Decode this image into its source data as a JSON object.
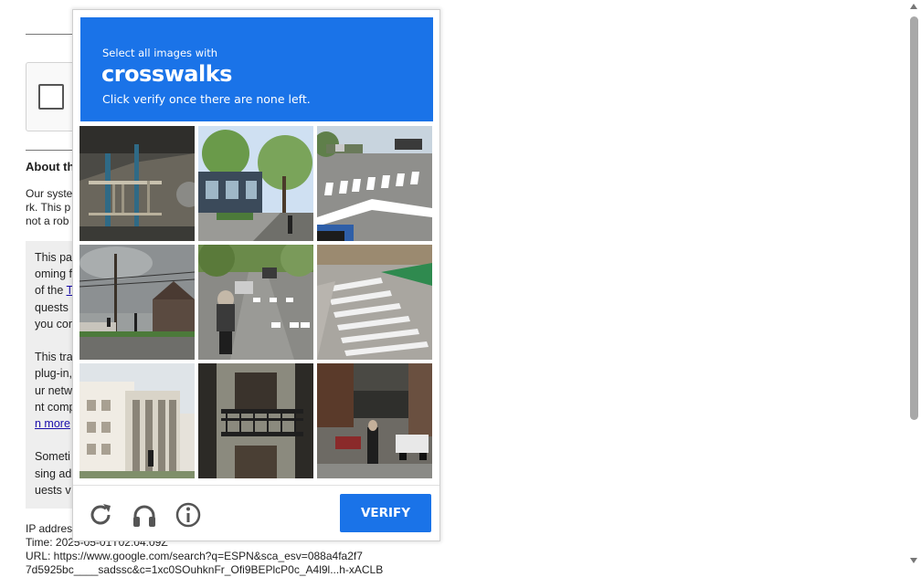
{
  "background": {
    "about_heading": "About th",
    "para1": [
      "Our syste",
      "rk. This p",
      "not a rob"
    ],
    "grey_block": [
      "This pa",
      "oming f",
      "of the ",
      "T",
      "quests",
      "you con",
      "This tra",
      "plug-in,",
      "ur netw",
      "nt comp",
      "n more",
      "Someti",
      "sing ad",
      "uests v"
    ],
    "ip_line": "IP addres",
    "time_line": "Time: 2025-05-01T02:04:09Z",
    "url_line": "URL: https://www.google.com/search?q=ESPN&sca_esv=088a4fa2f7",
    "url_cont": "7d5925bc____sadssc&c=1xc0SOuhknFr_Ofi9BEPlcP0c_A4l9l...h-xACLB"
  },
  "captcha": {
    "instruction": "Select all images with",
    "target": "crosswalks",
    "subtitle": "Click verify once there are none left.",
    "tiles": [
      {
        "label": "station-platform"
      },
      {
        "label": "street-with-building"
      },
      {
        "label": "road-with-crosswalk"
      },
      {
        "label": "utility-pole-intersection"
      },
      {
        "label": "motorcycle-crosswalk"
      },
      {
        "label": "painted-crosswalk"
      },
      {
        "label": "white-building"
      },
      {
        "label": "balcony"
      },
      {
        "label": "busy-street"
      }
    ],
    "verify_label": "VERIFY",
    "icons": {
      "reload": "reload-icon",
      "audio": "headphones-icon",
      "info": "info-icon"
    },
    "colors": {
      "header": "#1a73e8",
      "button": "#1a73e8",
      "icon": "#555555"
    }
  }
}
